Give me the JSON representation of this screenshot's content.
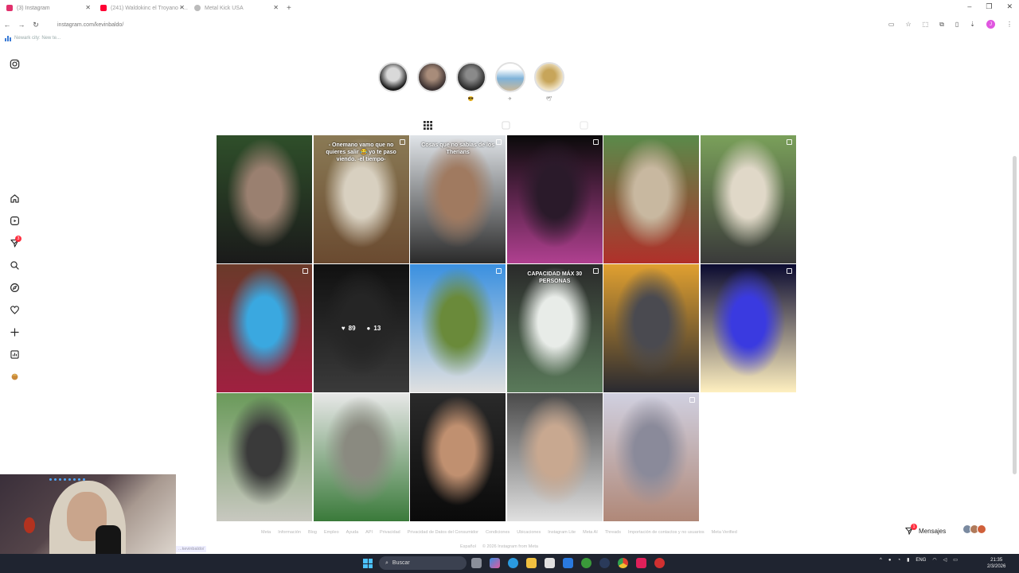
{
  "browser": {
    "tabs": [
      {
        "label": "(3) Instagram",
        "color": "#e1306c",
        "active": true
      },
      {
        "label": "(241) Waldokinc el Troyano - ...",
        "color": "#ff0033",
        "active": false
      },
      {
        "label": "Metal Kick USA",
        "color": "#888888",
        "active": false
      }
    ],
    "new_tab": "+",
    "url": "instagram.com/kevinbaldo/",
    "bookmark": "Newark city: New te...",
    "profile_initial": "J"
  },
  "instagram": {
    "nav_icons": [
      "instagram-logo-icon",
      "home-icon",
      "reels-icon",
      "messages-icon",
      "search-icon",
      "explore-icon",
      "heart-icon",
      "create-icon",
      "dashboard-icon",
      "profile-avatar"
    ],
    "notifications_count": "3",
    "highlights": [
      {
        "caption": "",
        "color1": "#1a1a1a",
        "color2": "#d9d9d9"
      },
      {
        "caption": "",
        "color1": "#3a3030",
        "color2": "#a88c7a"
      },
      {
        "caption": "😎",
        "color1": "#2a2a2a",
        "color2": "#8a8a8a"
      },
      {
        "caption": "✈",
        "color1": "#7fb2d9",
        "color2": "#c9b89a"
      },
      {
        "caption": "🕊",
        "color1": "#c7a55a",
        "color2": "#f0e4c8"
      }
    ],
    "posts": [
      {
        "caption": "",
        "c1": "#2f4f2a",
        "c2": "#9a8070",
        "c3": "#1a1a1a",
        "multi": false
      },
      {
        "caption": "- Onemano vamo que no quieres salir 😂 yo te paso viendo.\n\n-el tiempo-",
        "c1": "#8a7a55",
        "c2": "#d8d0c0",
        "c3": "#6a4a30",
        "multi": true
      },
      {
        "caption": "Cosas que no sabías de los Therians",
        "c1": "#e0e4e8",
        "c2": "#a07a60",
        "c3": "#2a2a2a",
        "multi": true
      },
      {
        "caption": "",
        "c1": "#0a0a0a",
        "c2": "#2a1a2a",
        "c3": "#b04090",
        "multi": true
      },
      {
        "caption": "",
        "c1": "#5a8a4a",
        "c2": "#c8b8a0",
        "c3": "#b0302a",
        "multi": false
      },
      {
        "caption": "",
        "c1": "#7aa05a",
        "c2": "#e0d8c8",
        "c3": "#3a3a3a",
        "multi": true
      },
      {
        "caption": "",
        "c1": "#6a3a2a",
        "c2": "#3aa8e0",
        "c3": "#a02040",
        "multi": true
      },
      {
        "caption": "",
        "c1": "#1a1a1a",
        "c2": "#3a3a3a",
        "c3": "#5a5a5a",
        "multi": false
      },
      {
        "caption": "",
        "c1": "#3a90e0",
        "c2": "#6a8a3a",
        "c3": "#e0e0e0",
        "multi": true
      },
      {
        "caption": "CAPACIDAD MÁX 30 PERSONAS",
        "c1": "#2a2a2a",
        "c2": "#e8ece8",
        "c3": "#5a7a5a",
        "multi": true
      },
      {
        "caption": "",
        "c1": "#e0a030",
        "c2": "#4a4a50",
        "c3": "#2a2a30",
        "multi": false
      },
      {
        "caption": "",
        "c1": "#0a0a30",
        "c2": "#3a3ae0",
        "c3": "#fff0c0",
        "multi": true
      },
      {
        "caption": "",
        "c1": "#6a9a5a",
        "c2": "#3a3a3a",
        "c3": "#c8c8c0",
        "multi": false
      },
      {
        "caption": "",
        "c1": "#e8e8e8",
        "c2": "#8a8a80",
        "c3": "#3a7a3a",
        "multi": false
      },
      {
        "caption": "",
        "c1": "#2a2a2a",
        "c2": "#c09070",
        "c3": "#0a0a0a",
        "multi": false
      },
      {
        "caption": "",
        "c1": "#4a4a4a",
        "c2": "#c8a890",
        "c3": "#e0e0e0",
        "multi": false
      },
      {
        "caption": "",
        "c1": "#d0d0e0",
        "c2": "#8a8a9a",
        "c3": "#b08878",
        "multi": true
      }
    ],
    "hover": {
      "post_index": 7,
      "likes": "89",
      "comments": "13"
    },
    "footer_links": [
      "Meta",
      "Información",
      "Blog",
      "Empleo",
      "Ayuda",
      "API",
      "Privacidad",
      "Privacidad de Datos del Consumidor",
      "Condiciones",
      "Ubicaciones",
      "Instagram Lite",
      "Meta AI",
      "Threads",
      "Importación de contactos y no usuarios",
      "Meta Verified"
    ],
    "footer_copy": [
      "Español",
      "© 2026 Instagram from Meta"
    ],
    "messages_label": "Mensajes",
    "messages_count": "1"
  },
  "taskbar": {
    "search_placeholder": "Buscar",
    "lang": "ENG",
    "time": "21:35",
    "date": "2/3/2026"
  },
  "status_url": "...kevinbaldo/"
}
